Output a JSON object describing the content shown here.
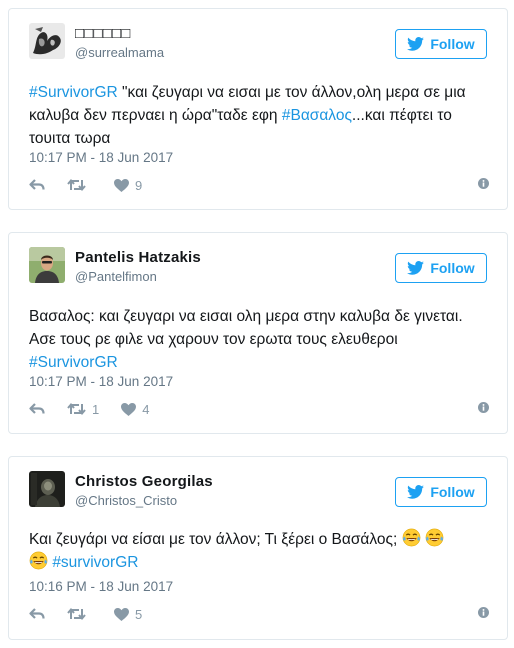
{
  "follow_label": "Follow",
  "accent": "#1da1f2",
  "tweets": [
    {
      "name": "□□□□□□",
      "handle": "@surrealmama",
      "avatar": "grayscale-hand-photo",
      "text": {
        "t1": "#SurvivorGR",
        "t2": " \"και ζευγαρι να εισαι με τον άλλον,ολη μερα σε μια",
        "t3": "καλυβα δεν περναει η ώρα\"ταδε εφη ",
        "t4": "#Βασαλος",
        "t5": "...και πέφτει το",
        "t6": "τουιτα τωρα"
      },
      "time": "10:17 PM - 18 Jun 2017",
      "retweets": "",
      "likes": "9"
    },
    {
      "name": "Pantelis Hatzakis",
      "handle": "@Pantelfimon",
      "avatar": "man-portrait-photo",
      "text": {
        "l1": "Βασαλος: και ζευγαρι να εισαι ολη μερα στην καλυβα δε γινεται.",
        "l2": "Ασε τους ρε φιλε να χαρουν τον ερωτα τους ελευθεροι",
        "tag": "#SurvivorGR"
      },
      "time": "10:17 PM - 18 Jun 2017",
      "retweets": "1",
      "likes": "4"
    },
    {
      "name": "Christos Georgilas",
      "handle": "@Christos_Cristo",
      "avatar": "dark-figure-photo",
      "text": {
        "l1": "Και ζευγάρι να είσαι με τον άλλον; Τι ξέρει ο Βασάλος;",
        "tag": "#survivorGR",
        "emoji": "tears-of-joy-emoji"
      },
      "time": "10:16 PM - 18 Jun 2017",
      "retweets": "",
      "likes": "5"
    }
  ]
}
